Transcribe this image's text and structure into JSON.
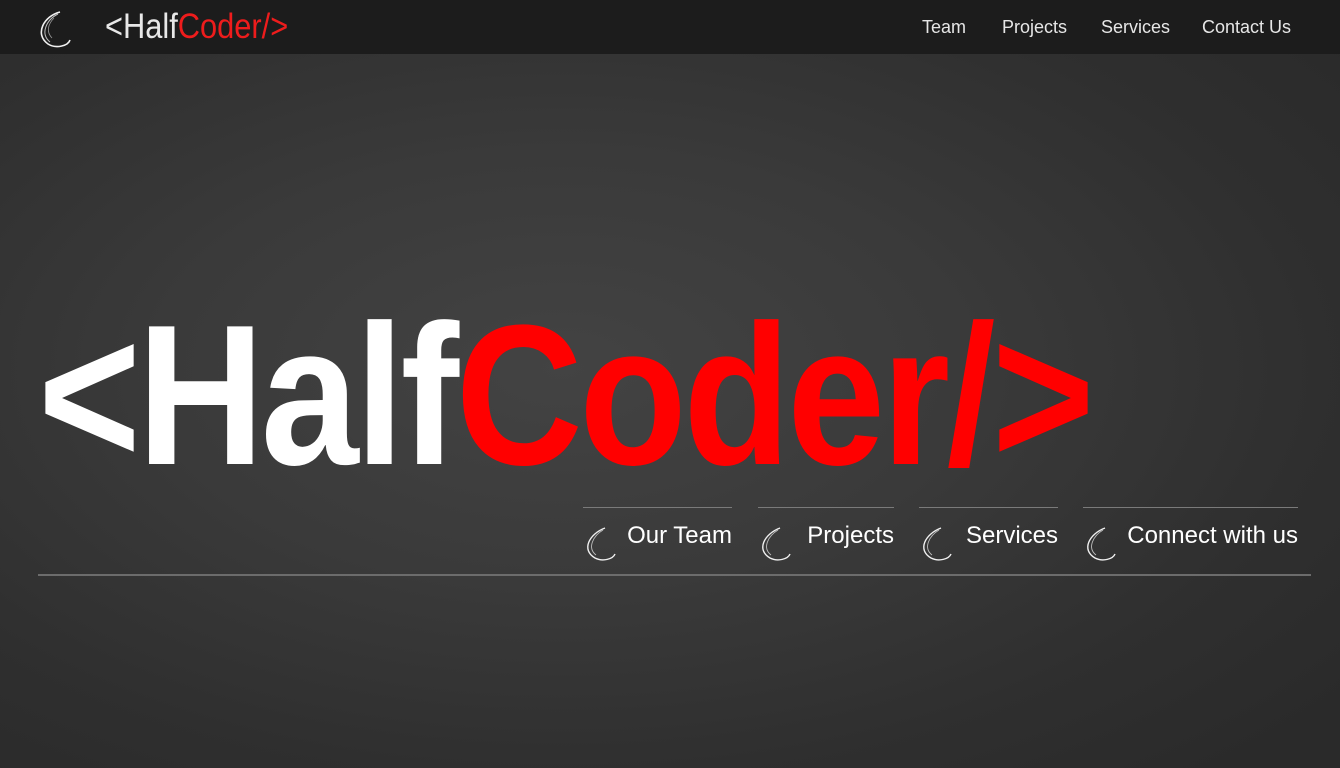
{
  "navbar": {
    "brand": {
      "open": "<Half",
      "close": "Coder/>"
    },
    "links": [
      "Team",
      "Projects",
      "Services",
      "Contact Us"
    ]
  },
  "hero": {
    "title": {
      "open": "<Half",
      "close": "Coder/>"
    },
    "quick_links": [
      "Our Team",
      "Projects",
      "Services",
      "Connect with us"
    ]
  },
  "icons": {
    "logo": "orbit-swirl-icon"
  },
  "colors": {
    "accent": "#ff0000",
    "navbar_bg": "#1c1c1c",
    "page_bg": "#3a3a3a",
    "text": "#ffffff"
  }
}
